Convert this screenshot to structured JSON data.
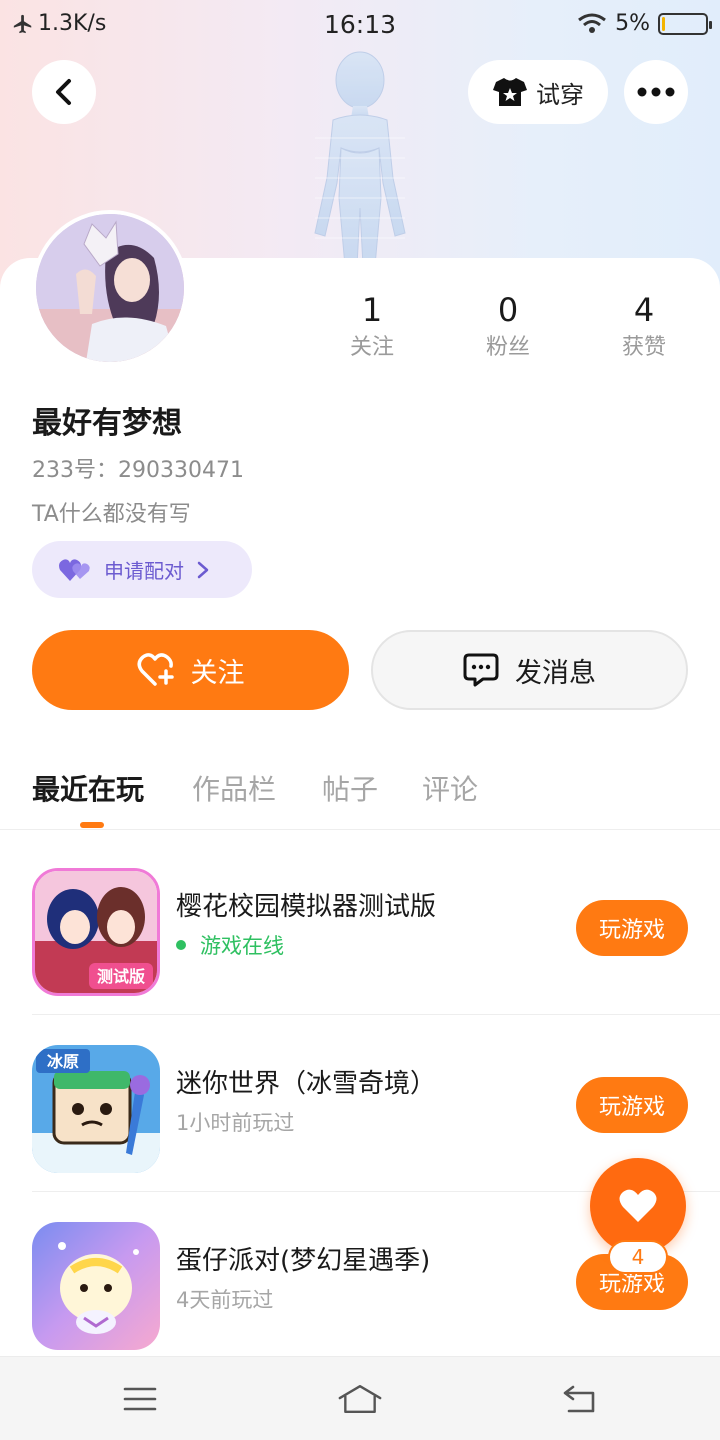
{
  "status_bar": {
    "network_speed": "1.3K/s",
    "time": "16:13",
    "battery_percent": "5%",
    "battery_level": 0.05
  },
  "header": {
    "tryon_label": "试穿"
  },
  "profile": {
    "stats": [
      {
        "value": "1",
        "label": "关注"
      },
      {
        "value": "0",
        "label": "粉丝"
      },
      {
        "value": "4",
        "label": "获赞"
      }
    ],
    "name": "最好有梦想",
    "uid": "233号：290330471",
    "bio": "TA什么都没有写",
    "match_label": "申请配对"
  },
  "actions": {
    "follow_label": "关注",
    "message_label": "发消息"
  },
  "tabs": [
    "最近在玩",
    "作品栏",
    "帖子",
    "评论"
  ],
  "games": [
    {
      "title": "樱花校园模拟器测试版",
      "status": "游戏在线",
      "button": "玩游戏"
    },
    {
      "title": "迷你世界（冰雪奇境）",
      "status": "1小时前玩过",
      "button": "玩游戏"
    },
    {
      "title": "蛋仔派对(梦幻星遇季)",
      "status": "4天前玩过",
      "button": "玩游戏"
    }
  ],
  "icon_labels": {
    "game1": "测试版",
    "game2": "冰原"
  },
  "fab": {
    "like_count": "4"
  },
  "colors": {
    "accent": "#ff7a12",
    "online": "#2fc061",
    "match": "#6c5bd0"
  }
}
